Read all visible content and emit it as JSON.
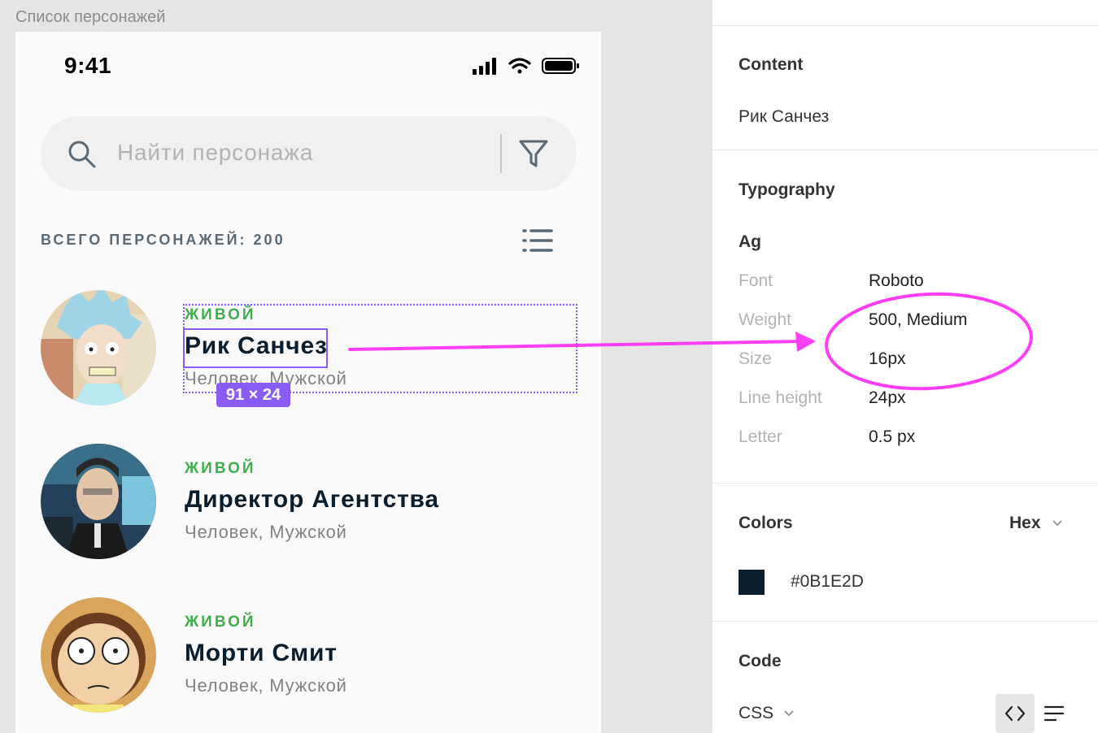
{
  "canvas": {
    "frame_label": "Список персонажей",
    "phone": {
      "time": "9:41",
      "search_placeholder": "Найти персонажа",
      "total_label": "ВСЕГО ПЕРСОНАЖЕЙ: 200",
      "characters": [
        {
          "status": "ЖИВОЙ",
          "name": "Рик Санчез",
          "meta": "Человек, Мужской"
        },
        {
          "status": "ЖИВОЙ",
          "name": "Директор Агентства",
          "meta": "Человек, Мужской"
        },
        {
          "status": "ЖИВОЙ",
          "name": "Морти Смит",
          "meta": "Человек, Мужской"
        }
      ]
    },
    "selection_badge": "91 × 24"
  },
  "inspector": {
    "content": {
      "title": "Content",
      "value": "Рик Санчез"
    },
    "typography": {
      "title": "Typography",
      "sample": "Ag",
      "rows": [
        {
          "label": "Font",
          "value": "Roboto"
        },
        {
          "label": "Weight",
          "value": "500, Medium"
        },
        {
          "label": "Size",
          "value": "16px"
        },
        {
          "label": "Line height",
          "value": "24px"
        },
        {
          "label": "Letter",
          "value": "0.5 px"
        }
      ]
    },
    "colors": {
      "title": "Colors",
      "format": "Hex",
      "swatch_hex": "#0B1E2D",
      "swatch_color": "#0b1e2d"
    },
    "code": {
      "title": "Code",
      "language": "CSS"
    }
  },
  "accents": {
    "selection": "#8a5cf6",
    "annotation": "#ff3df5",
    "status_green": "#3fae4c"
  }
}
